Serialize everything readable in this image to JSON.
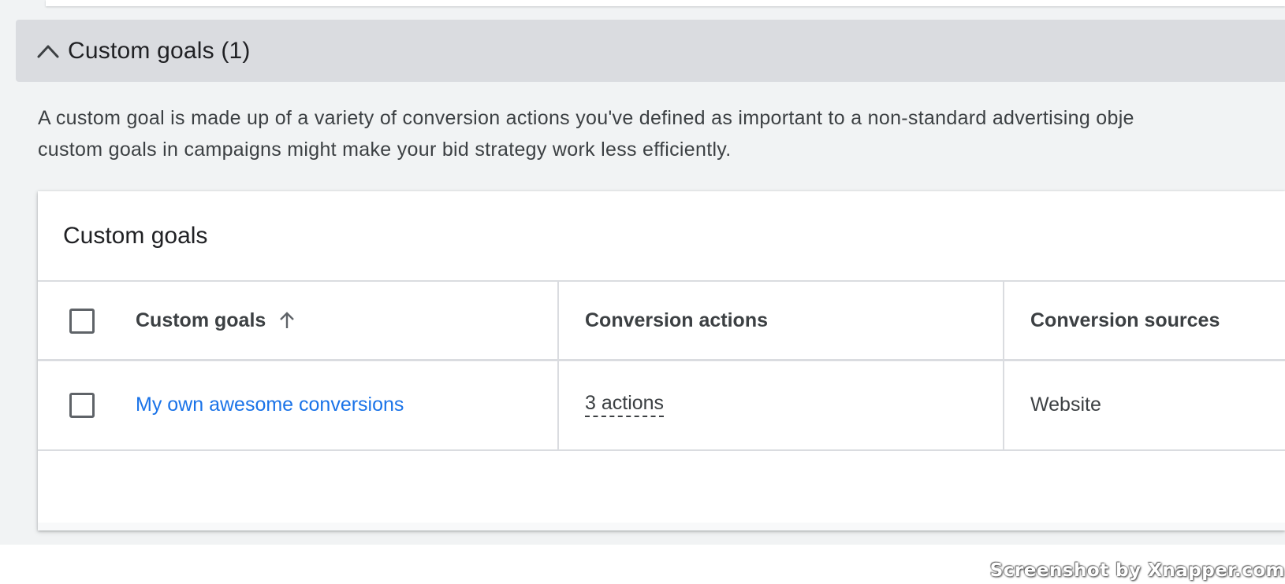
{
  "section": {
    "title": "Custom goals (1)",
    "chevron_icon": "chevron-up-icon",
    "description_line1": "A custom goal is made up of a variety of conversion actions you've defined as important to a non-standard advertising obje",
    "description_line2": "custom goals in campaigns might make your bid strategy work less efficiently."
  },
  "card": {
    "title": "Custom goals",
    "table": {
      "columns": [
        "Custom goals",
        "Conversion actions",
        "Conversion sources"
      ],
      "sort_icon": "arrow-up-icon",
      "rows": [
        {
          "goal": "My own awesome conversions",
          "actions": "3 actions",
          "sources": "Website"
        }
      ]
    }
  },
  "watermark": "Screenshot by Xnapper.com",
  "colors": {
    "link": "#1a73e8",
    "header_bg": "#dadce0",
    "page_bg": "#f1f3f4"
  }
}
